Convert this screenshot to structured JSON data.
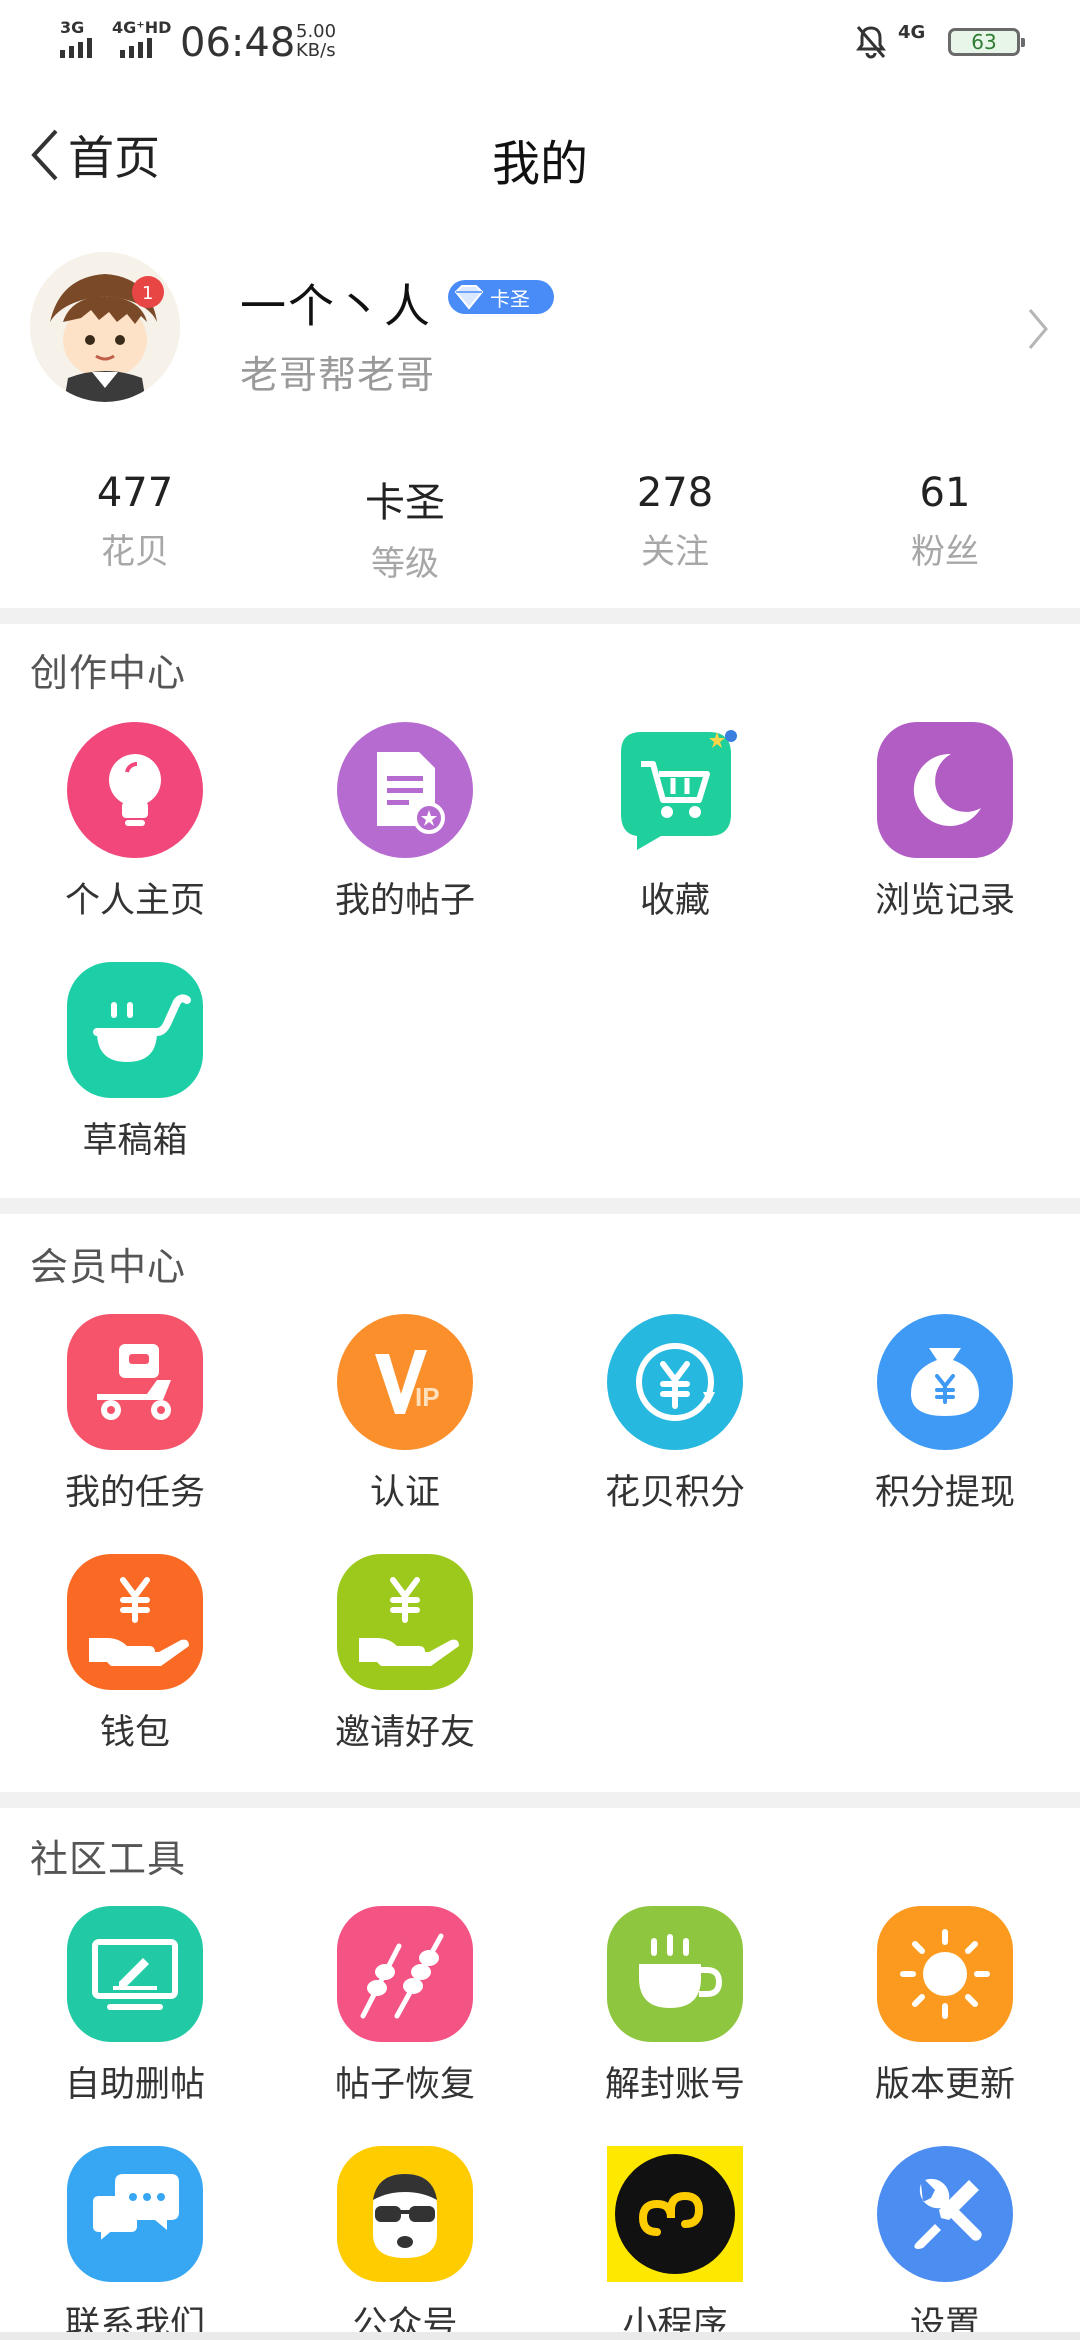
{
  "status": {
    "sig1": "3G",
    "sig2": "4G⁺HD",
    "time": "06:48",
    "speed_value": "5.00",
    "speed_unit": "KB/s",
    "network": "4G",
    "battery": "63"
  },
  "nav": {
    "back_label": "首页",
    "title": "我的"
  },
  "profile": {
    "name": "一个丶人",
    "level_badge": "卡圣",
    "signature": "老哥帮老哥"
  },
  "stats": [
    {
      "value": "477",
      "label": "花贝"
    },
    {
      "value": "卡圣",
      "label": "等级"
    },
    {
      "value": "278",
      "label": "关注"
    },
    {
      "value": "61",
      "label": "粉丝"
    }
  ],
  "sections": {
    "creation": {
      "title": "创作中心",
      "items": [
        {
          "label": "个人主页",
          "icon": "lightbulb-icon",
          "color": "#f2477a"
        },
        {
          "label": "我的帖子",
          "icon": "document-icon",
          "color": "#b66bd0"
        },
        {
          "label": "收藏",
          "icon": "cart-icon",
          "color": "#1fcf9c"
        },
        {
          "label": "浏览记录",
          "icon": "moon-icon",
          "color": "#b15dc4"
        },
        {
          "label": "草稿箱",
          "icon": "draft-box-icon",
          "color": "#1dcfa6"
        }
      ]
    },
    "member": {
      "title": "会员中心",
      "items": [
        {
          "label": "我的任务",
          "icon": "scooter-icon",
          "color": "#f6546a"
        },
        {
          "label": "认证",
          "icon": "vip-icon",
          "color": "#fb8f2b"
        },
        {
          "label": "花贝积分",
          "icon": "yen-coin-icon",
          "color": "#27b8e0"
        },
        {
          "label": "积分提现",
          "icon": "money-bag-icon",
          "color": "#3e9af4"
        },
        {
          "label": "钱包",
          "icon": "hand-yen-icon",
          "color": "#fb6a24"
        },
        {
          "label": "邀请好友",
          "icon": "hand-yen-icon",
          "color": "#9cc91c"
        }
      ]
    },
    "tools": {
      "title": "社区工具",
      "items": [
        {
          "label": "自助删帖",
          "icon": "monitor-icon",
          "color": "#21c9a4"
        },
        {
          "label": "帖子恢复",
          "icon": "skewer-icon",
          "color": "#f45484"
        },
        {
          "label": "解封账号",
          "icon": "coffee-cup-icon",
          "color": "#8ec63f"
        },
        {
          "label": "版本更新",
          "icon": "sun-icon",
          "color": "#fb9a1e"
        },
        {
          "label": "联系我们",
          "icon": "chat-icon",
          "color": "#37a7f3"
        },
        {
          "label": "公众号",
          "icon": "face-glasses-icon",
          "color": "#ffcc00"
        },
        {
          "label": "小程序",
          "icon": "mini-program-icon",
          "color": "#111111"
        },
        {
          "label": "设置",
          "icon": "wrench-icon",
          "color": "#4b8df0"
        }
      ]
    }
  }
}
